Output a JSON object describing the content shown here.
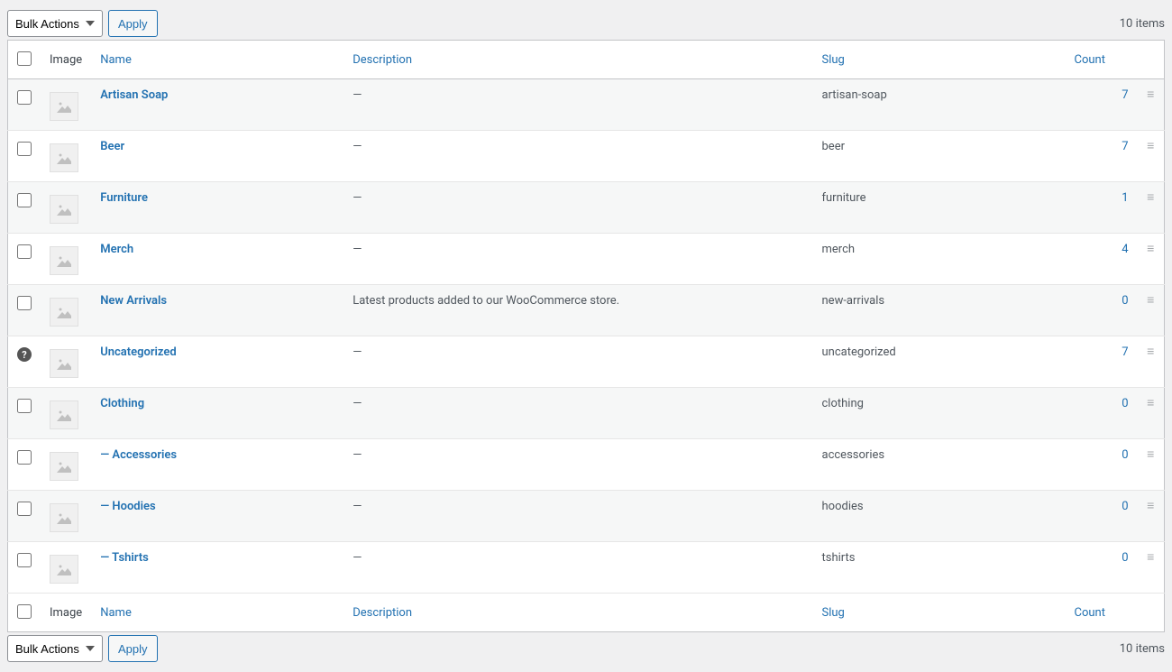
{
  "bulk_actions_label": "Bulk Actions",
  "apply_label": "Apply",
  "items_count_text": "10 items",
  "columns": {
    "image": "Image",
    "name": "Name",
    "description": "Description",
    "slug": "Slug",
    "count": "Count"
  },
  "em_dash": "—",
  "child_prefix": "— ",
  "rows": [
    {
      "name": "Artisan Soap",
      "description": "",
      "slug": "artisan-soap",
      "count": "7",
      "child": false,
      "help": false
    },
    {
      "name": "Beer",
      "description": "",
      "slug": "beer",
      "count": "7",
      "child": false,
      "help": false
    },
    {
      "name": "Furniture",
      "description": "",
      "slug": "furniture",
      "count": "1",
      "child": false,
      "help": false
    },
    {
      "name": "Merch",
      "description": "",
      "slug": "merch",
      "count": "4",
      "child": false,
      "help": false
    },
    {
      "name": "New Arrivals",
      "description": "Latest products added to our WooCommerce store.",
      "slug": "new-arrivals",
      "count": "0",
      "child": false,
      "help": false
    },
    {
      "name": "Uncategorized",
      "description": "",
      "slug": "uncategorized",
      "count": "7",
      "child": false,
      "help": true
    },
    {
      "name": "Clothing",
      "description": "",
      "slug": "clothing",
      "count": "0",
      "child": false,
      "help": false
    },
    {
      "name": "Accessories",
      "description": "",
      "slug": "accessories",
      "count": "0",
      "child": true,
      "help": false
    },
    {
      "name": "Hoodies",
      "description": "",
      "slug": "hoodies",
      "count": "0",
      "child": true,
      "help": false
    },
    {
      "name": "Tshirts",
      "description": "",
      "slug": "tshirts",
      "count": "0",
      "child": true,
      "help": false
    }
  ]
}
